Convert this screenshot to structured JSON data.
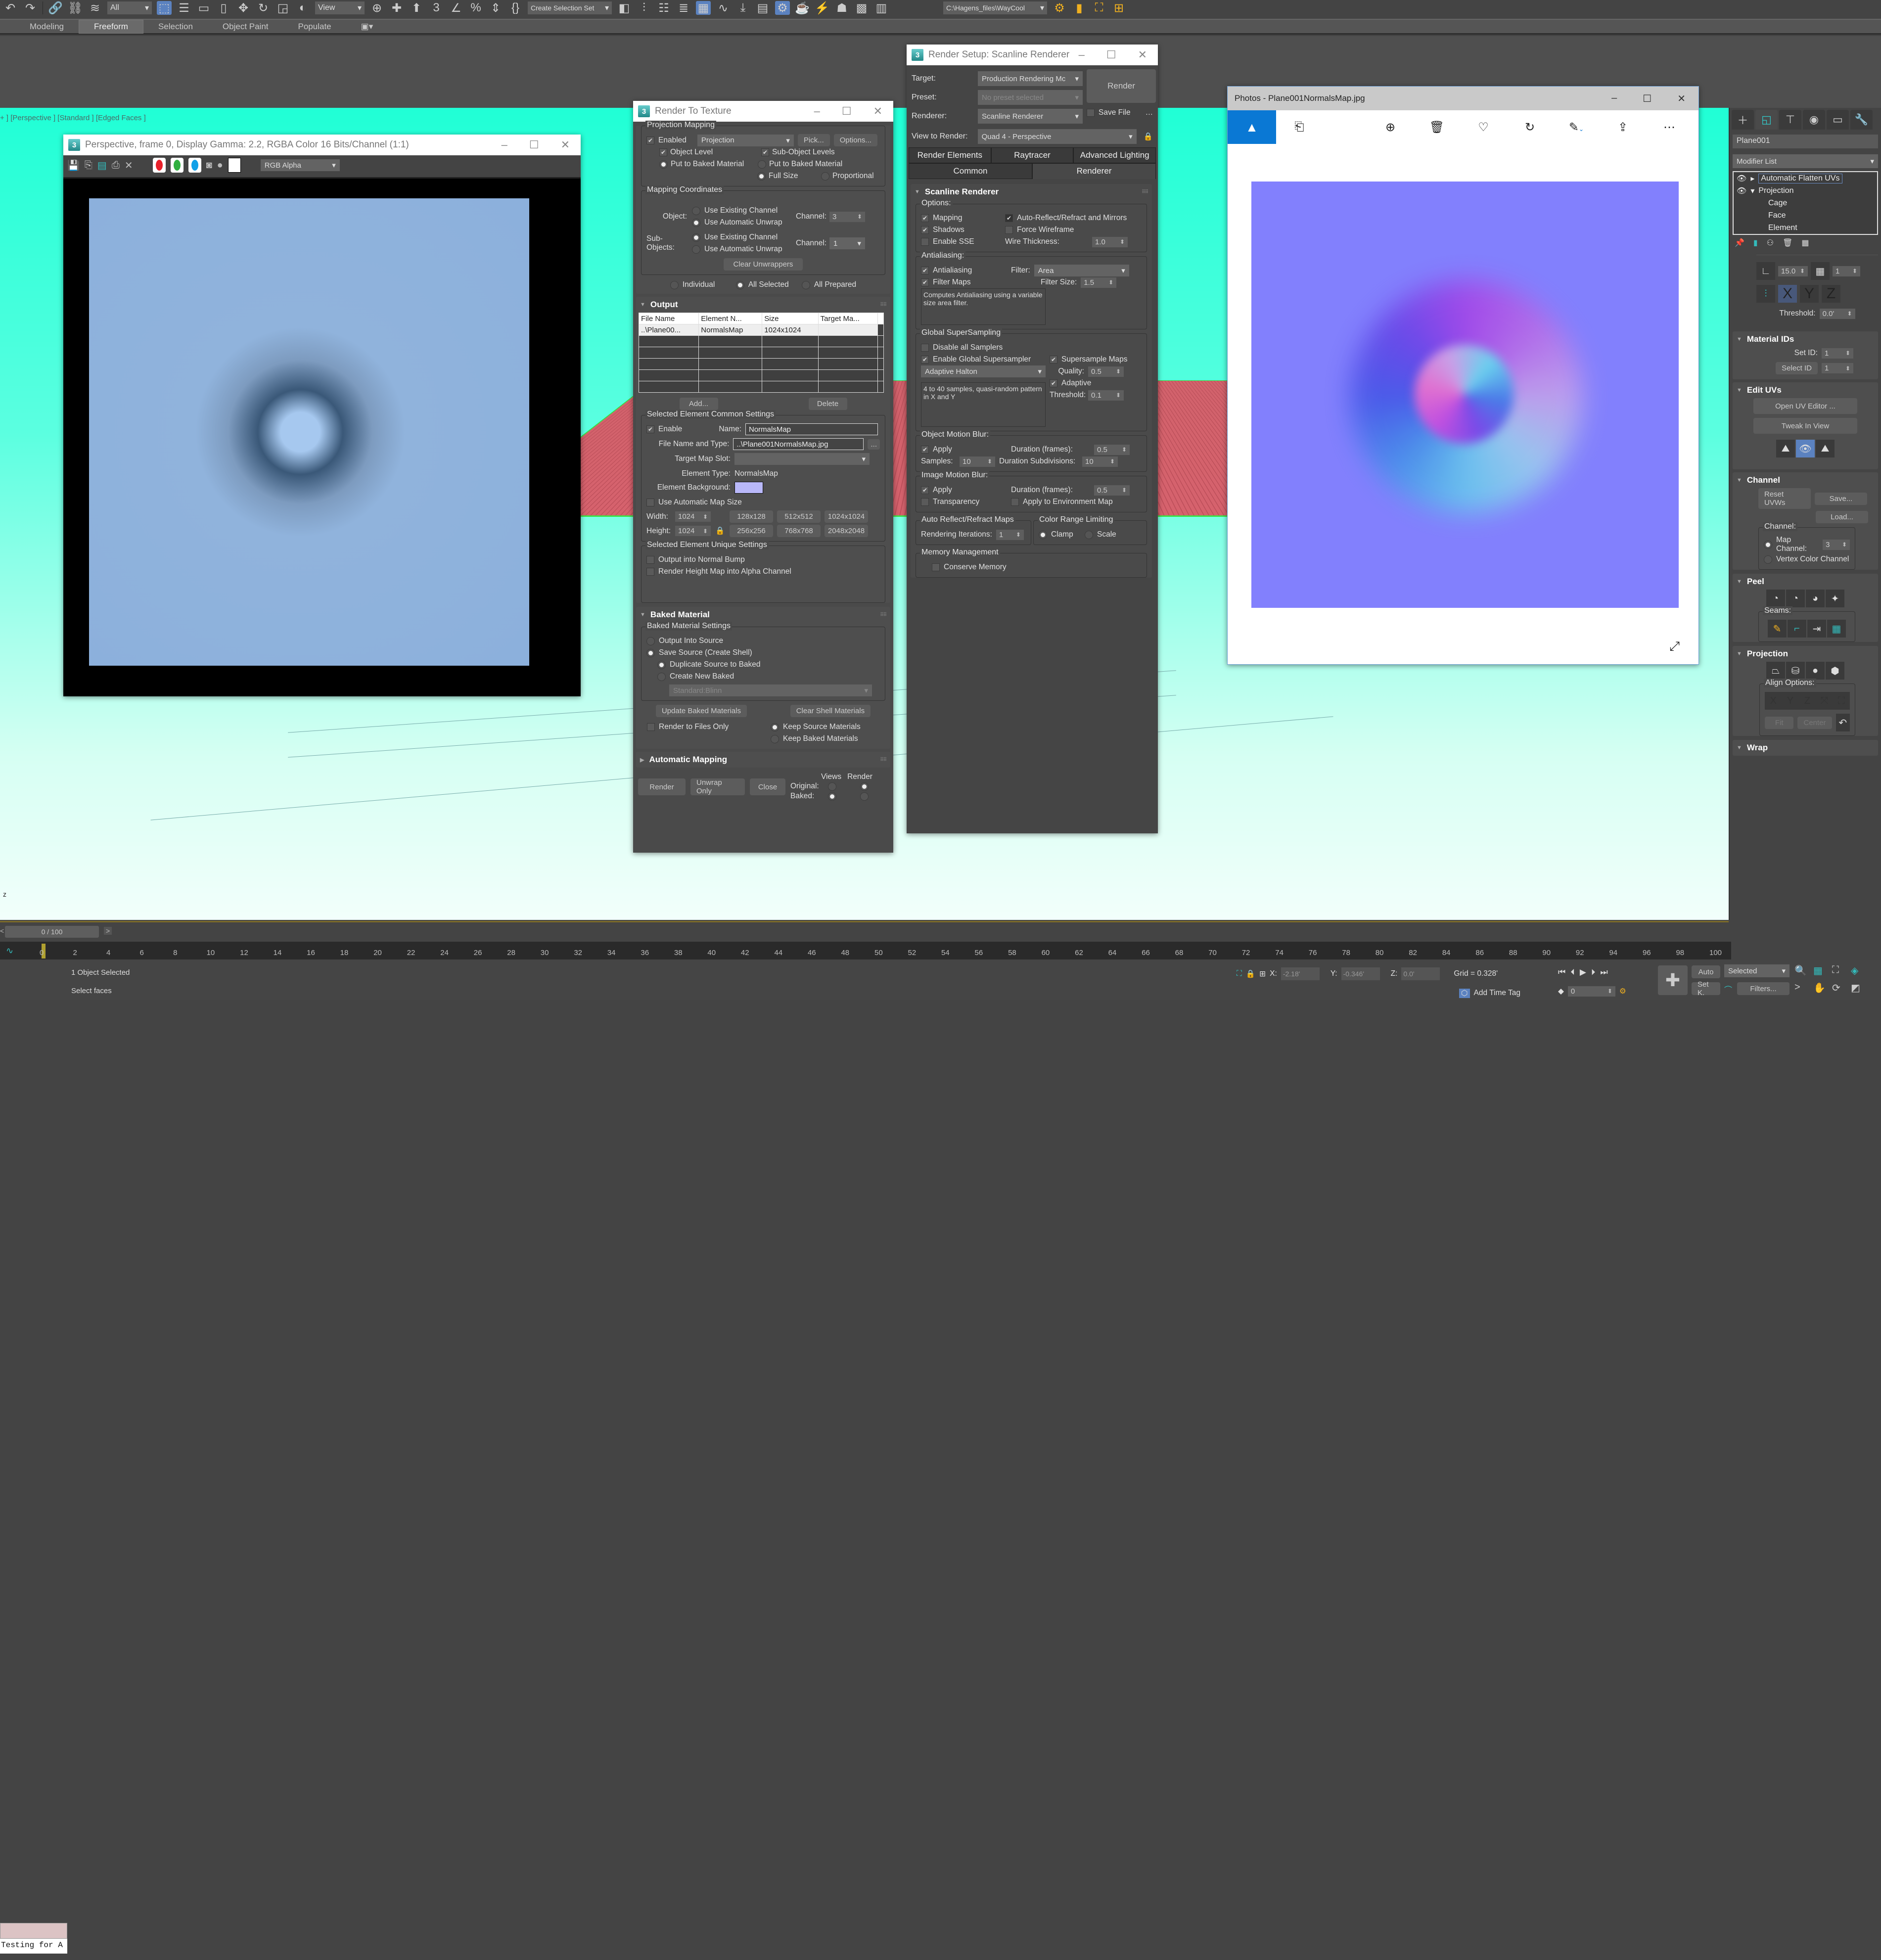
{
  "toolbar": {
    "selection_filter": "All",
    "ref_coord": "View",
    "named_selection": "Create Selection Set",
    "project_path": "C:\\Hagens_files\\WayCool"
  },
  "ribbon": {
    "tabs": [
      {
        "label": "Modeling",
        "active": false
      },
      {
        "label": "Freeform",
        "active": true
      },
      {
        "label": "Selection",
        "active": false
      },
      {
        "label": "Object Paint",
        "active": false
      },
      {
        "label": "Populate",
        "active": false
      }
    ]
  },
  "viewport": {
    "label": "+ ] [Perspective ] [Standard ] [Edged Faces ]",
    "axis_label": "z"
  },
  "frame_buffer": {
    "title": "Perspective, frame 0, Display Gamma: 2.2, RGBA Color 16 Bits/Channel (1:1)",
    "channel_display": "RGB Alpha",
    "icons": [
      "save-icon",
      "copy-icon",
      "clone-icon",
      "print-icon",
      "clear-icon"
    ],
    "channel_buttons": [
      {
        "name": "red-channel",
        "color": "#e8202a"
      },
      {
        "name": "green-channel",
        "color": "#30b040"
      },
      {
        "name": "blue-channel",
        "color": "#10a0e8"
      }
    ]
  },
  "render_to_texture": {
    "title": "Render To Texture",
    "projection_mapping": {
      "label": "Projection Mapping",
      "enabled_label": "Enabled",
      "enabled": true,
      "modifier": "Projection",
      "pick_label": "Pick...",
      "options_label": "Options...",
      "object_level_label": "Object Level",
      "object_level": true,
      "sub_object_levels_label": "Sub-Object Levels",
      "sub_object_levels": true,
      "put_to_baked_left": "Put to Baked Material",
      "put_to_baked_right": "Put to Baked Material",
      "full_size": "Full Size",
      "proportional": "Proportional"
    },
    "mapping_coordinates": {
      "label": "Mapping Coordinates",
      "object_label": "Object:",
      "sub_objects_label": "Sub-Objects:",
      "use_existing": "Use Existing Channel",
      "use_auto_unwrap": "Use Automatic Unwrap",
      "channel_label": "Channel:",
      "object_channel": "3",
      "sub_channel": "1",
      "clear_unwrappers": "Clear Unwrappers"
    },
    "scope": {
      "individual": "Individual",
      "all_selected": "All Selected",
      "all_prepared": "All Prepared",
      "selected": "All Selected"
    },
    "output": {
      "title": "Output",
      "columns": [
        "File Name",
        "Element N...",
        "Size",
        "Target Ma..."
      ],
      "rows": [
        [
          "..\\Plane00...",
          "NormalsMap",
          "1024x1024",
          ""
        ]
      ],
      "add_label": "Add...",
      "delete_label": "Delete"
    },
    "common_settings": {
      "label": "Selected Element Common Settings",
      "enable_label": "Enable",
      "enable": true,
      "name_label": "Name:",
      "name_value": "NormalsMap",
      "file_label": "File Name and Type:",
      "file_value": "..\\Plane001NormalsMap.jpg",
      "browse_label": "...",
      "target_slot_label": "Target Map Slot:",
      "target_slot_value": "",
      "element_type_label": "Element Type:",
      "element_type_value": "NormalsMap",
      "element_bg_label": "Element Background:",
      "element_bg_color": "#b9b8f9",
      "auto_size_label": "Use Automatic Map Size",
      "auto_size": false,
      "width_label": "Width:",
      "width": "1024",
      "height_label": "Height:",
      "height": "1024",
      "presets": [
        "128x128",
        "512x512",
        "1024x1024",
        "256x256",
        "768x768",
        "2048x2048"
      ]
    },
    "unique_settings": {
      "label": "Selected Element Unique Settings",
      "normal_bump": "Output into Normal Bump",
      "height_alpha": "Render Height Map into Alpha Channel"
    },
    "baked_material": {
      "title": "Baked Material",
      "settings_label": "Baked Material Settings",
      "output_into_source": "Output Into Source",
      "save_source": "Save Source (Create Shell)",
      "duplicate": "Duplicate Source to Baked",
      "create_new": "Create New Baked",
      "material_type": "Standard:Blinn",
      "update_label": "Update Baked Materials",
      "clear_label": "Clear Shell Materials",
      "render_files_only": "Render to Files Only",
      "keep_source": "Keep Source Materials",
      "keep_baked": "Keep Baked Materials"
    },
    "automatic_mapping": {
      "title": "Automatic Mapping"
    },
    "footer": {
      "render": "Render",
      "unwrap_only": "Unwrap Only",
      "close": "Close",
      "views": "Views",
      "render_col": "Render",
      "original": "Original:",
      "baked": "Baked:"
    }
  },
  "render_setup": {
    "title": "Render Setup: Scanline Renderer",
    "target_label": "Target:",
    "target_value": "Production Rendering Mc",
    "preset_label": "Preset:",
    "preset_value": "No preset selected",
    "renderer_label": "Renderer:",
    "renderer_value": "Scanline Renderer",
    "save_file_label": "Save File",
    "render_button": "Render",
    "view_label": "View to Render:",
    "view_value": "Quad 4 - Perspective",
    "tabs_row1": [
      "Render Elements",
      "Raytracer",
      "Advanced Lighting"
    ],
    "tabs_row2": [
      {
        "label": "Common",
        "active": false
      },
      {
        "label": "Renderer",
        "active": true
      }
    ],
    "rollout_title": "Scanline Renderer",
    "options": {
      "label": "Options:",
      "mapping": "Mapping",
      "shadows": "Shadows",
      "enable_sse": "Enable SSE",
      "auto_reflect": "Auto-Reflect/Refract and Mirrors",
      "force_wire": "Force Wireframe",
      "wire_thickness_label": "Wire Thickness:",
      "wire_thickness": "1.0"
    },
    "antialiasing": {
      "label": "Antialiasing:",
      "antialiasing": "Antialiasing",
      "filter_label": "Filter:",
      "filter_value": "Area",
      "filter_maps": "Filter Maps",
      "filter_size_label": "Filter Size:",
      "filter_size": "1.5",
      "description": "Computes Antialiasing using a variable size area filter."
    },
    "supersampling": {
      "label": "Global SuperSampling",
      "disable_all": "Disable all Samplers",
      "enable_global": "Enable Global Supersampler",
      "supersample_maps": "Supersample Maps",
      "sampler": "Adaptive Halton",
      "quality_label": "Quality:",
      "quality": "0.5",
      "adaptive": "Adaptive",
      "threshold_label": "Threshold:",
      "threshold": "0.1",
      "description": "4 to 40 samples, quasi-random pattern in X and Y"
    },
    "object_motion_blur": {
      "label": "Object Motion Blur:",
      "apply": "Apply",
      "duration_label": "Duration (frames):",
      "duration": "0.5",
      "samples_label": "Samples:",
      "samples": "10",
      "subdiv_label": "Duration Subdivisions:",
      "subdiv": "10"
    },
    "image_motion_blur": {
      "label": "Image Motion Blur:",
      "apply": "Apply",
      "duration_label": "Duration (frames):",
      "duration": "0.5",
      "transparency": "Transparency",
      "env_map": "Apply to Environment Map"
    },
    "auto_reflect": {
      "label": "Auto Reflect/Refract Maps",
      "iterations_label": "Rendering Iterations:",
      "iterations": "1"
    },
    "color_range": {
      "label": "Color Range Limiting",
      "clamp": "Clamp",
      "scale": "Scale"
    },
    "memory": {
      "label": "Memory Management",
      "conserve": "Conserve Memory"
    }
  },
  "photos": {
    "title": "Photos - Plane001NormalsMap.jpg",
    "toolbar_icons": [
      "zoom-in-icon",
      "delete-icon",
      "favorite-icon",
      "rotate-icon",
      "edit-icon",
      "share-icon",
      "more-icon"
    ],
    "image_base_color": "#8280fd"
  },
  "command_panel": {
    "object_name": "Plane001",
    "modifier_list": "Modifier List",
    "stack": [
      {
        "label": "Automatic Flatten UVs",
        "level": 0,
        "selected": true
      },
      {
        "label": "Projection",
        "level": 0,
        "expanded": true
      },
      {
        "label": "Cage",
        "level": 1
      },
      {
        "label": "Face",
        "level": 1
      },
      {
        "label": "Element",
        "level": 1
      }
    ],
    "angle_value": "15.0",
    "grid_value": "1",
    "threshold_label": "Threshold:",
    "threshold_value": "0.0'",
    "material_ids": {
      "title": "Material IDs",
      "set_id_label": "Set ID:",
      "set_id": "1",
      "select_id_label": "Select ID",
      "select_id": "1"
    },
    "edit_uvs": {
      "title": "Edit UVs",
      "open_editor": "Open UV Editor ...",
      "tweak": "Tweak In View"
    },
    "channel": {
      "title": "Channel",
      "reset": "Reset UVWs",
      "save": "Save...",
      "load": "Load...",
      "group_label": "Channel:",
      "map_channel_label": "Map Channel:",
      "map_channel": "3",
      "vertex_color": "Vertex Color Channel"
    },
    "peel": {
      "title": "Peel",
      "seams_label": "Seams:"
    },
    "projection": {
      "title": "Projection",
      "align_label": "Align Options:",
      "fit": "Fit",
      "center": "Center"
    },
    "wrap": {
      "title": "Wrap"
    }
  },
  "timeline": {
    "frame_display": "0 / 100",
    "current_frame": 0,
    "total_frames": 100,
    "ticks": [
      0,
      2,
      4,
      6,
      8,
      10,
      12,
      14,
      16,
      18,
      20,
      22,
      24,
      26,
      28,
      30,
      32,
      34,
      36,
      38,
      40,
      42,
      44,
      46,
      48,
      50,
      52,
      54,
      56,
      58,
      60,
      62,
      64,
      66,
      68,
      70,
      72,
      74,
      76,
      78,
      80,
      82,
      84,
      86,
      88,
      90,
      92,
      94,
      96,
      98,
      100
    ]
  },
  "status": {
    "maxscript_text": "Testing for A",
    "line1": "1 Object Selected",
    "line2": "Select faces",
    "x_label": "X:",
    "x": "-2.18'",
    "y_label": "Y:",
    "y": "-0.346'",
    "z_label": "Z:",
    "z": "0.0'",
    "grid": "Grid = 0.328'",
    "add_time_tag": "Add Time Tag",
    "frame_field": "0",
    "auto_key": "Auto",
    "set_key": "Set K.",
    "key_mode": "Selected",
    "filters": "Filters..."
  }
}
